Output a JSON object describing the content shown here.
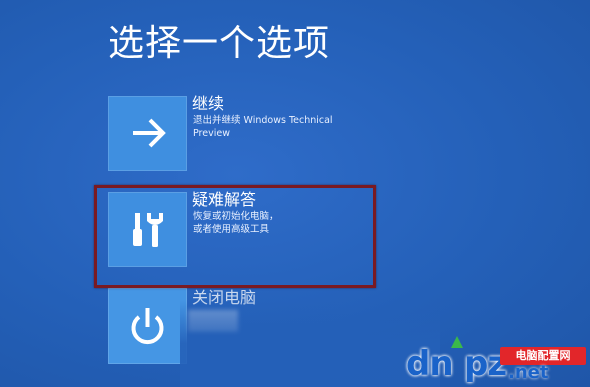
{
  "page": {
    "title": "选择一个选项"
  },
  "options": [
    {
      "label": "继续",
      "desc_line1": "退出并继续 Windows Technical",
      "desc_line2": "Preview",
      "icon": "arrow-right-icon"
    },
    {
      "label": "疑难解答",
      "desc_line1": "恢复或初始化电脑，",
      "desc_line2": "或者使用高级工具",
      "icon": "wrench-screwdriver-icon"
    },
    {
      "label": "关闭电脑",
      "icon": "power-icon"
    }
  ],
  "watermark": {
    "brand_left": "dn",
    "brand_right": "pz",
    "badge": "电脑配置网",
    "domain": ".net"
  },
  "colors": {
    "background": "#2460b8",
    "tile": "#3f8fe0",
    "highlight_border": "#7a1a22",
    "watermark_blue": "#1a63c9",
    "watermark_red": "#e2262a"
  }
}
